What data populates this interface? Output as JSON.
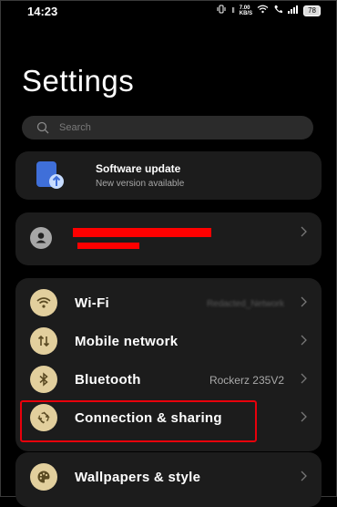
{
  "status_bar": {
    "time": "14:23",
    "speed_value": "7.00",
    "speed_unit": "KB/S",
    "battery": "78"
  },
  "page_title": "Settings",
  "search": {
    "placeholder": "Search"
  },
  "software_update": {
    "title": "Software update",
    "subtitle": "New version available"
  },
  "account": {
    "redacted": true
  },
  "settings_items": [
    {
      "label": "Wi-Fi",
      "value": "Redacted_Network",
      "icon": "wifi-icon"
    },
    {
      "label": "Mobile network",
      "value": "",
      "icon": "mobile-network-icon"
    },
    {
      "label": "Bluetooth",
      "value": "Rockerz 235V2",
      "icon": "bluetooth-icon"
    },
    {
      "label": "Connection & sharing",
      "value": "",
      "icon": "connection-sharing-icon"
    }
  ],
  "settings_items2": [
    {
      "label": "Wallpapers & style",
      "icon": "palette-icon"
    }
  ],
  "colors": {
    "background": "#000000",
    "card": "#1c1c1c",
    "icon_bg": "#e2cf9d",
    "highlight": "#e8000b"
  }
}
